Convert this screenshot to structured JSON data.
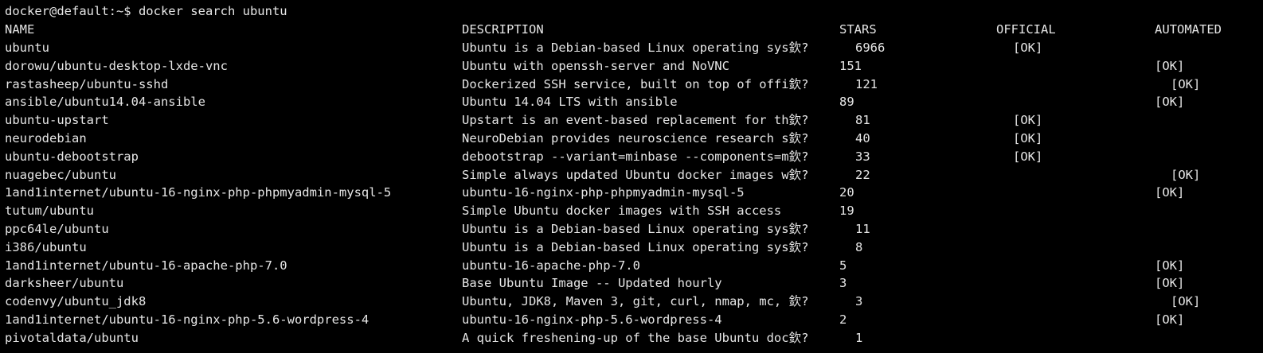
{
  "terminal": {
    "prompt": "docker@default:~$ docker search ubuntu",
    "headers": {
      "name": "NAME",
      "description": "DESCRIPTION",
      "stars": "STARS",
      "official": "OFFICIAL",
      "automated": "AUTOMATED"
    },
    "rows": [
      {
        "name": "ubuntu",
        "description": "Ubuntu is a Debian-based Linux operating sys欽?",
        "stars": "6966",
        "official": "[OK]",
        "automated": ""
      },
      {
        "name": "dorowu/ubuntu-desktop-lxde-vnc",
        "description": "Ubuntu with openssh-server and NoVNC",
        "stars": "151",
        "official": "",
        "automated": "[OK]"
      },
      {
        "name": "rastasheep/ubuntu-sshd",
        "description": "Dockerized SSH service, built on top of offi欽?",
        "stars": "121",
        "official": "",
        "automated": "[OK]"
      },
      {
        "name": "ansible/ubuntu14.04-ansible",
        "description": "Ubuntu 14.04 LTS with ansible",
        "stars": "89",
        "official": "",
        "automated": "[OK]"
      },
      {
        "name": "ubuntu-upstart",
        "description": "Upstart is an event-based replacement for th欽?",
        "stars": "81",
        "official": "[OK]",
        "automated": ""
      },
      {
        "name": "neurodebian",
        "description": "NeuroDebian provides neuroscience research s欽?",
        "stars": "40",
        "official": "[OK]",
        "automated": ""
      },
      {
        "name": "ubuntu-debootstrap",
        "description": "debootstrap --variant=minbase --components=m欽?",
        "stars": "33",
        "official": "[OK]",
        "automated": ""
      },
      {
        "name": "nuagebec/ubuntu",
        "description": "Simple always updated Ubuntu docker images w欽?",
        "stars": "22",
        "official": "",
        "automated": "[OK]"
      },
      {
        "name": "1and1internet/ubuntu-16-nginx-php-phpmyadmin-mysql-5",
        "description": "ubuntu-16-nginx-php-phpmyadmin-mysql-5",
        "stars": "20",
        "official": "",
        "automated": "[OK]"
      },
      {
        "name": "tutum/ubuntu",
        "description": "Simple Ubuntu docker images with SSH access",
        "stars": "19",
        "official": "",
        "automated": ""
      },
      {
        "name": "ppc64le/ubuntu",
        "description": "Ubuntu is a Debian-based Linux operating sys欽?",
        "stars": "11",
        "official": "",
        "automated": ""
      },
      {
        "name": "i386/ubuntu",
        "description": "Ubuntu is a Debian-based Linux operating sys欽?",
        "stars": "8",
        "official": "",
        "automated": ""
      },
      {
        "name": "1and1internet/ubuntu-16-apache-php-7.0",
        "description": "ubuntu-16-apache-php-7.0",
        "stars": "5",
        "official": "",
        "automated": "[OK]"
      },
      {
        "name": "darksheer/ubuntu",
        "description": "Base Ubuntu Image -- Updated hourly",
        "stars": "3",
        "official": "",
        "automated": "[OK]"
      },
      {
        "name": "codenvy/ubuntu_jdk8",
        "description": "Ubuntu, JDK8, Maven 3, git, curl, nmap, mc, 欽?",
        "stars": "3",
        "official": "",
        "automated": "[OK]"
      },
      {
        "name": "1and1internet/ubuntu-16-nginx-php-5.6-wordpress-4",
        "description": "ubuntu-16-nginx-php-5.6-wordpress-4",
        "stars": "2",
        "official": "",
        "automated": "[OK]"
      },
      {
        "name": "pivotaldata/ubuntu",
        "description": "A quick freshening-up of the base Ubuntu doc欽?",
        "stars": "1",
        "official": "",
        "automated": ""
      }
    ]
  },
  "colors": {
    "background": "#000000",
    "text": "#e6e6e6"
  }
}
